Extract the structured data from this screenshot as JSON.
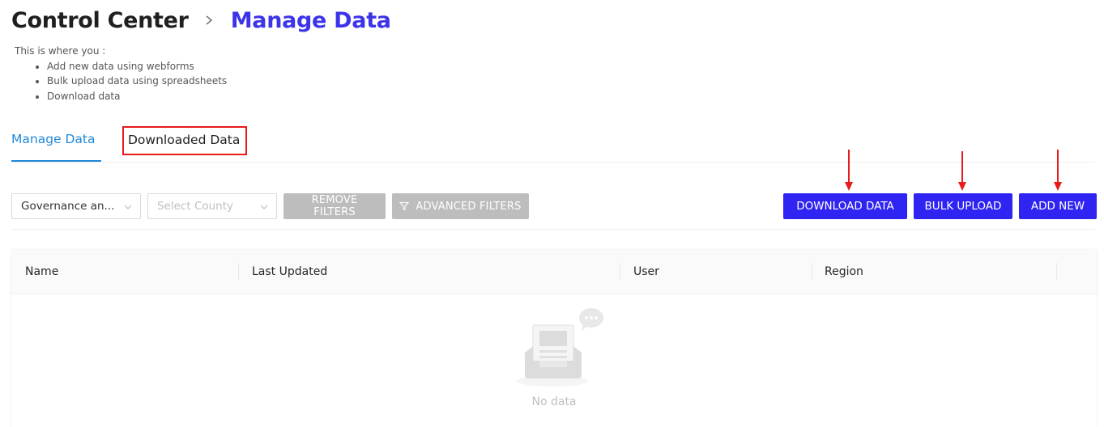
{
  "header": {
    "breadcrumb_root": "Control Center",
    "breadcrumb_current": "Manage Data",
    "separator_icon": "chevron-right-icon"
  },
  "intro": {
    "lead": "This is where you :",
    "items": [
      "Add new data using webforms",
      "Bulk upload data using spreadsheets",
      "Download data"
    ]
  },
  "tabs": [
    {
      "label": "Manage Data",
      "active": true
    },
    {
      "label": "Downloaded Data",
      "active": false
    }
  ],
  "filters": {
    "governance_value": "Governance an...",
    "county_placeholder": "Select County",
    "remove_filters_label": "REMOVE FILTERS",
    "advanced_filters_label": "ADVANCED FILTERS"
  },
  "actions": {
    "download_label": "DOWNLOAD DATA",
    "bulk_upload_label": "BULK UPLOAD",
    "add_new_label": "ADD NEW"
  },
  "table": {
    "columns": [
      "Name",
      "Last Updated",
      "User",
      "Region"
    ],
    "empty_text": "No data"
  },
  "colors": {
    "title_accent": "#3c34e8",
    "tab_active": "#2188d8",
    "primary_button": "#2f24f2",
    "disabled_button": "#bdbdbd",
    "annotation_red": "#e81a1a"
  }
}
